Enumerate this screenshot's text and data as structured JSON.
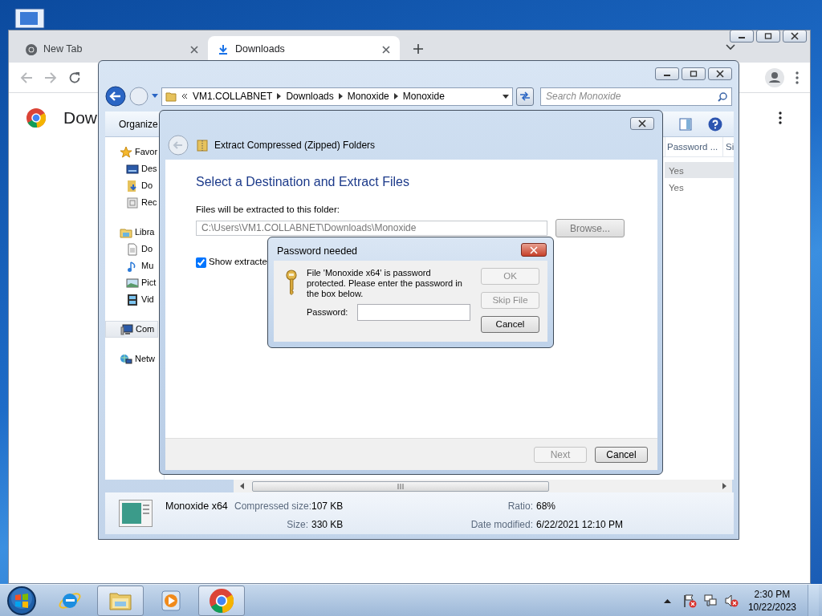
{
  "browser": {
    "tabs": [
      {
        "label": "New Tab",
        "selected": false
      },
      {
        "label": "Downloads",
        "selected": true
      }
    ],
    "page_title": "Dow"
  },
  "explorer": {
    "breadcrumb": [
      "VM1.COLLABNET",
      "Downloads",
      "Monoxide",
      "Monoxide"
    ],
    "search": {
      "placeholder": "Search Monoxide"
    },
    "organize": "Organize",
    "nav": [
      {
        "label": "Favor",
        "kind": "favorites",
        "selected": false,
        "children": [
          {
            "label": "Des",
            "kind": "desktop",
            "selected": false
          },
          {
            "label": "Do",
            "kind": "downloads",
            "selected": false
          },
          {
            "label": "Rec",
            "kind": "recent",
            "selected": false
          }
        ]
      },
      {
        "label": "Libra",
        "kind": "libraries",
        "selected": false,
        "children": [
          {
            "label": "Do",
            "kind": "documents",
            "selected": false
          },
          {
            "label": "Mu",
            "kind": "music",
            "selected": false
          },
          {
            "label": "Pict",
            "kind": "pictures",
            "selected": false
          },
          {
            "label": "Vid",
            "kind": "videos",
            "selected": false
          }
        ]
      },
      {
        "label": "Com",
        "kind": "computer",
        "selected": true
      },
      {
        "label": "Netw",
        "kind": "network",
        "selected": false
      }
    ],
    "columns": [
      "Password ...",
      "Si"
    ],
    "rows": [
      {
        "cells": [
          "Yes"
        ],
        "selected": true
      },
      {
        "cells": [
          "Yes"
        ],
        "selected": false
      }
    ],
    "details": {
      "name": "Monoxide x64",
      "fields": [
        {
          "label": "Compressed size:",
          "value": "107 KB"
        },
        {
          "label": "Ratio:",
          "value": "68%"
        },
        {
          "label": "Size:",
          "value": "330 KB"
        },
        {
          "label": "Date modified:",
          "value": "6/22/2021 12:10 PM"
        }
      ]
    }
  },
  "wizard": {
    "title": "Extract Compressed (Zipped) Folders",
    "heading": "Select a Destination and Extract Files",
    "folder_label": "Files will be extracted to this folder:",
    "folder_path": "C:\\Users\\VM1.COLLABNET\\Downloads\\Monoxide",
    "browse": "Browse...",
    "show_files": {
      "label": "Show extracte",
      "checked": true
    },
    "buttons": [
      {
        "label": "Next",
        "disabled": true
      },
      {
        "label": "Cancel",
        "disabled": false
      }
    ]
  },
  "password_dialog": {
    "title": "Password needed",
    "message": "File 'Monoxide x64' is password protected. Please enter the password in the box below.",
    "password_label": "Password:",
    "buttons": [
      {
        "label": "OK",
        "disabled": true
      },
      {
        "label": "Skip File",
        "disabled": true
      },
      {
        "label": "Cancel",
        "disabled": false
      }
    ]
  },
  "taskbar": {
    "apps": [
      {
        "kind": "ie",
        "selected": false
      },
      {
        "kind": "explorer",
        "selected": true
      },
      {
        "kind": "media",
        "selected": false
      },
      {
        "kind": "chrome",
        "selected": true
      }
    ],
    "time": "2:30 PM",
    "date": "10/22/2023"
  }
}
